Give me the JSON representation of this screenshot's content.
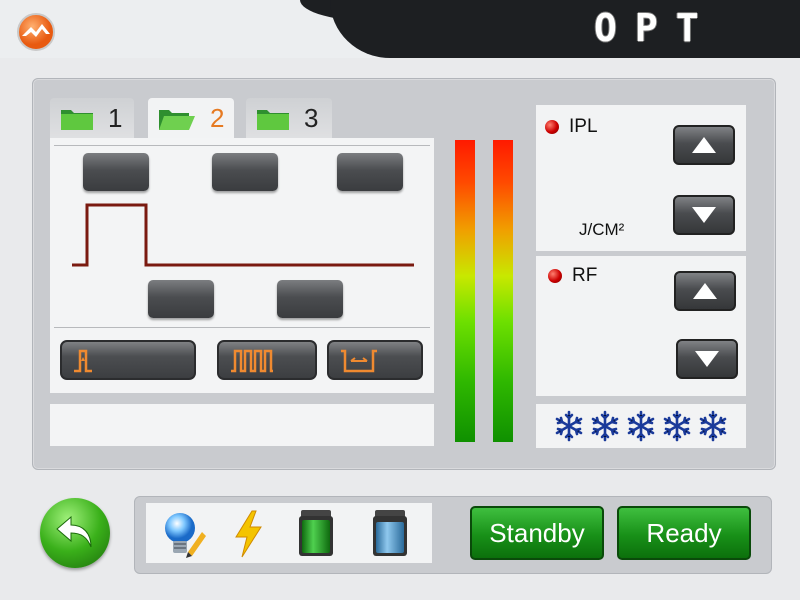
{
  "header": {
    "brand": "OPT"
  },
  "tabs": [
    {
      "label": "1"
    },
    {
      "label": "2"
    },
    {
      "label": "3"
    }
  ],
  "channels": {
    "ipl": {
      "label": "IPL",
      "unit": "J/CM²"
    },
    "rf": {
      "label": "RF"
    }
  },
  "bottom": {
    "standby_label": "Standby",
    "ready_label": "Ready"
  },
  "icons": {
    "back": "back-arrow-icon",
    "lamp": "lightbulb-pencil-icon",
    "power": "lightning-icon",
    "water_full": "water-tank-full-icon",
    "water_low": "water-tank-low-icon",
    "cooling": "snowflake-icon"
  },
  "colors": {
    "accent": "#e67a22",
    "green": "#189018",
    "snow": "#1a3a9a"
  }
}
